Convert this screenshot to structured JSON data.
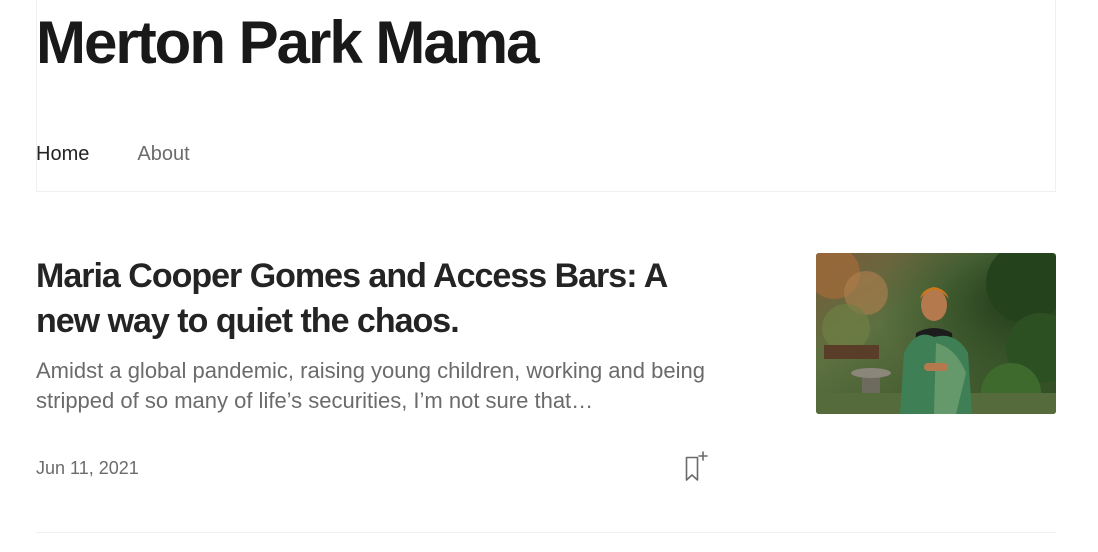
{
  "publication": {
    "title": "Merton Park Mama"
  },
  "nav": {
    "items": [
      {
        "label": "Home",
        "active": true
      },
      {
        "label": "About",
        "active": false
      }
    ]
  },
  "post": {
    "title": "Maria Cooper Gomes and Access Bars: A new way to quiet the chaos.",
    "excerpt": "Amidst a global pandemic, raising young children, working and being stripped of so many of life’s securities, I’m not sure that…",
    "date": "Jun 11, 2021",
    "bookmark_icon": "bookmark-add-icon",
    "image_alt": "Woman in a green patterned shawl standing in a garden"
  },
  "colors": {
    "text_primary": "#242424",
    "text_secondary": "#6b6b6b",
    "divider": "#f0f0f0"
  }
}
